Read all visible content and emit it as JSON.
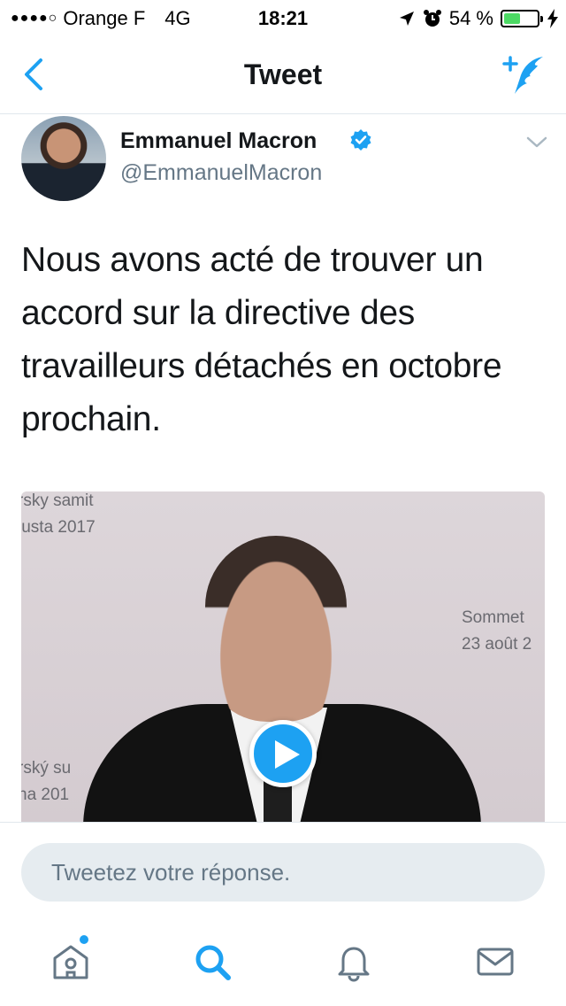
{
  "colors": {
    "accent": "#1da1f2",
    "text_primary": "#14171a",
    "text_secondary": "#657786",
    "battery_fill": "#4cd964"
  },
  "status_bar": {
    "signal": "●●●●○",
    "carrier": "Orange F",
    "network": "4G",
    "time": "18:21",
    "battery_percent": "54 %",
    "battery_level": 0.54
  },
  "nav": {
    "title": "Tweet"
  },
  "tweet": {
    "author_name": "Emmanuel Macron",
    "handle": "@EmmanuelMacron",
    "text": "Nous avons acté de trouver un accord sur la directive des travailleurs détachés en octobre prochain.",
    "media": {
      "caption_top_left": [
        "rsky samit",
        "justa 2017"
      ],
      "caption_right": [
        "Sommet",
        "23 août 2"
      ],
      "caption_bottom_left": [
        "rský su",
        "na 201"
      ]
    }
  },
  "reply": {
    "placeholder": "Tweetez votre réponse."
  },
  "tab_bar": {
    "items": [
      {
        "icon": "home-icon",
        "active": false,
        "has_dot": true
      },
      {
        "icon": "search-icon",
        "active": true
      },
      {
        "icon": "bell-icon",
        "active": false
      },
      {
        "icon": "envelope-icon",
        "active": false
      }
    ]
  }
}
